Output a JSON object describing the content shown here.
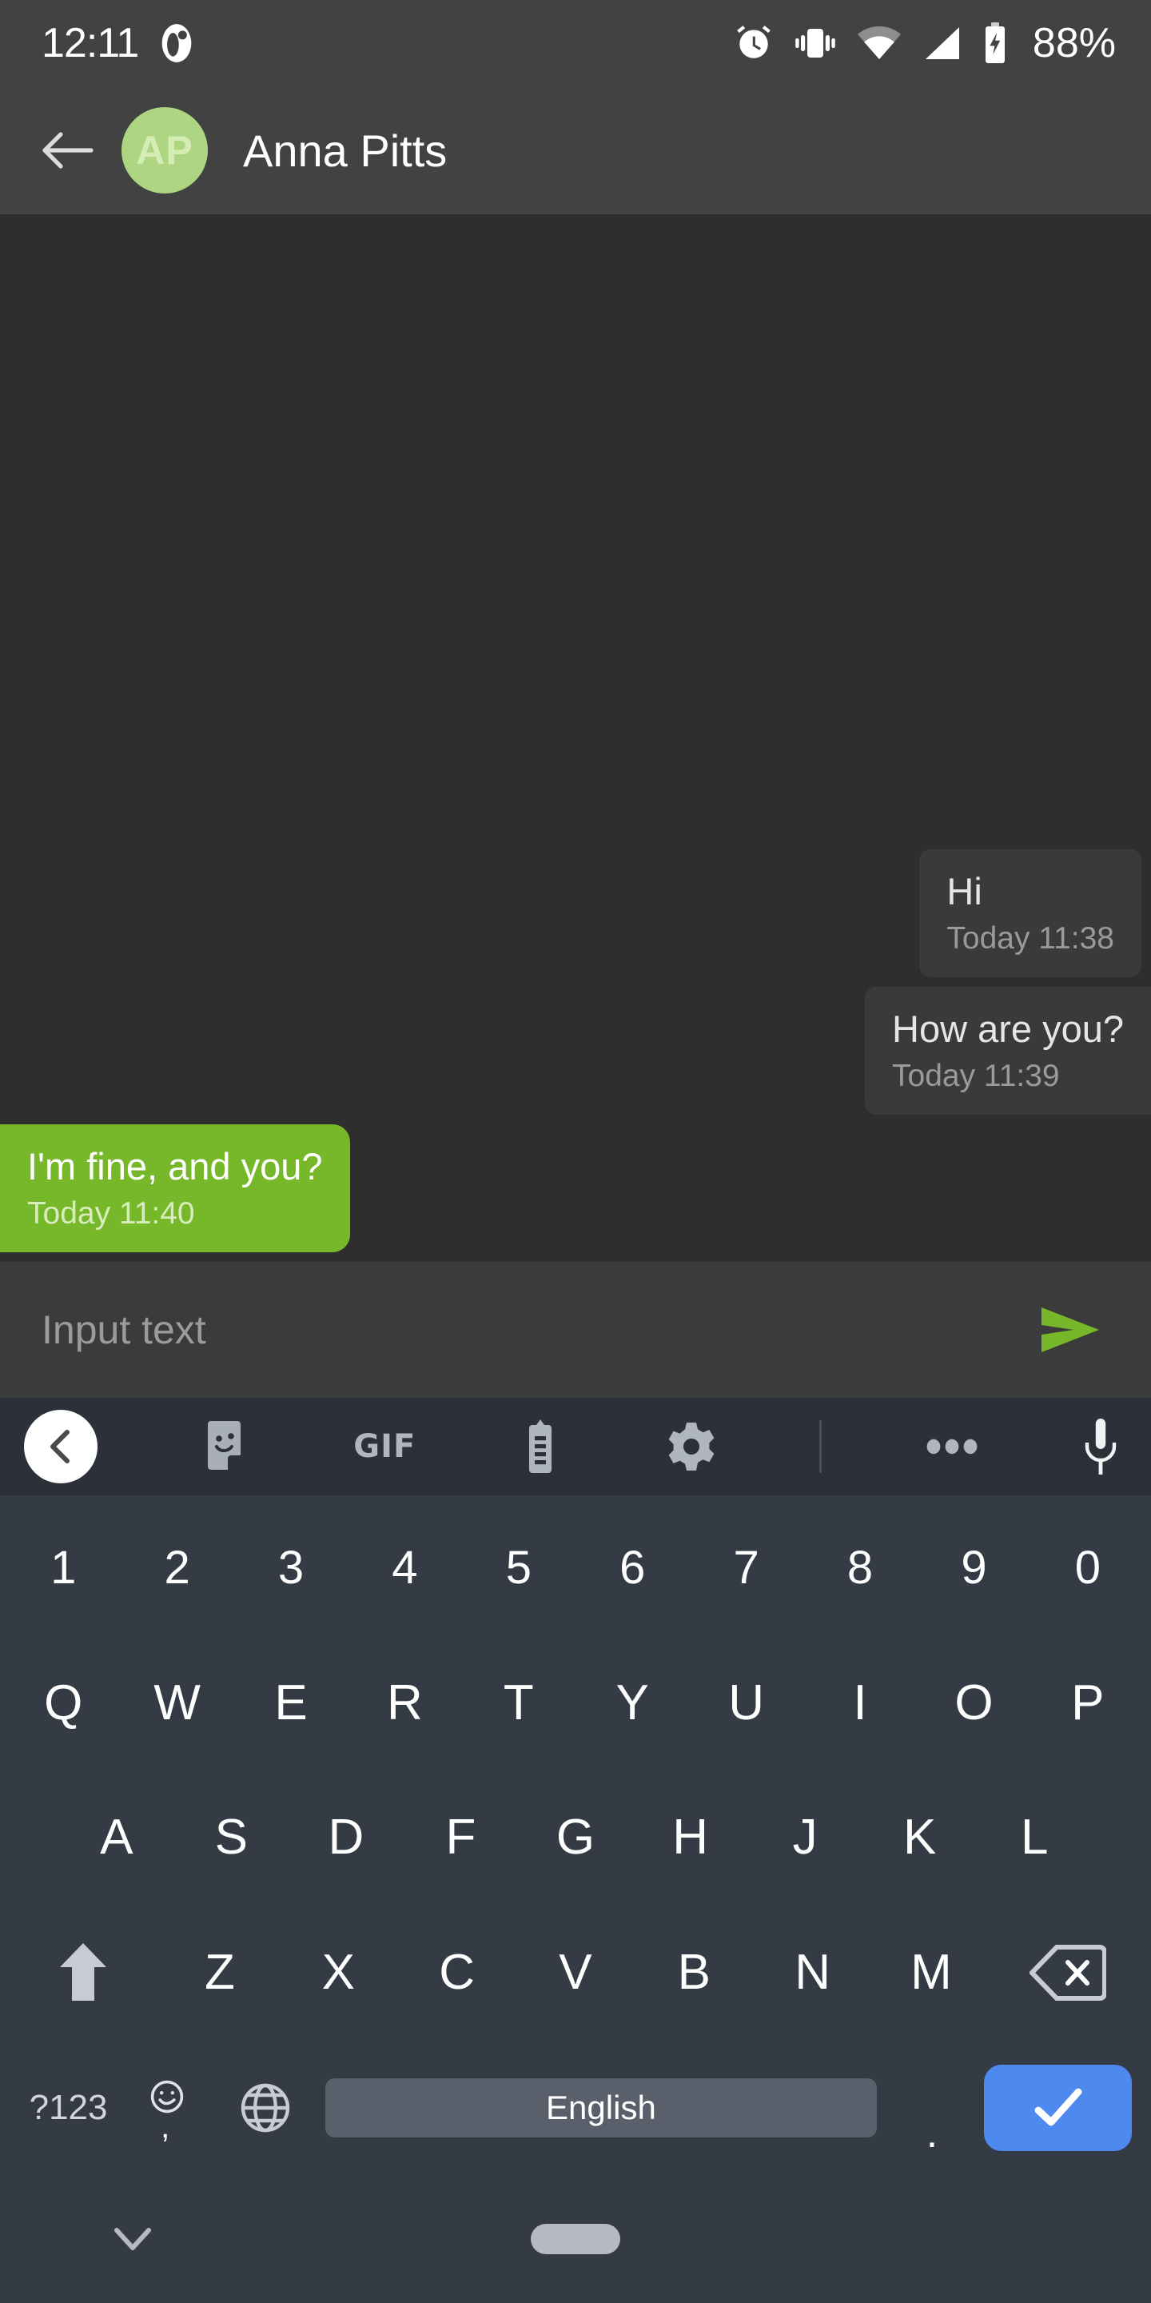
{
  "status_bar": {
    "time": "12:11",
    "battery_percent": "88%",
    "icons": [
      "notification-dot-icon",
      "alarm-icon",
      "vibrate-icon",
      "wifi-icon",
      "cellular-signal-icon",
      "battery-charging-icon"
    ]
  },
  "app_bar": {
    "back_label": "Back",
    "avatar_initials": "AP",
    "contact_name": "Anna Pitts",
    "avatar_color": "#aed581"
  },
  "messages": [
    {
      "text": "Hi",
      "time": "Today 11:38",
      "direction": "in"
    },
    {
      "text": "How are you?",
      "time": "Today 11:39",
      "direction": "in"
    },
    {
      "text": "I'm fine, and you?",
      "time": "Today 11:40",
      "direction": "out"
    }
  ],
  "input_bar": {
    "placeholder": "Input text",
    "send_label": "Send",
    "send_color": "#76b82a"
  },
  "keyboard_toolbar": {
    "items": [
      "collapse-toolbar",
      "sticker",
      "gif",
      "clipboard",
      "settings",
      "more-options",
      "voice-input"
    ],
    "gif_label": "GIF"
  },
  "keyboard": {
    "row_numbers": [
      "1",
      "2",
      "3",
      "4",
      "5",
      "6",
      "7",
      "8",
      "9",
      "0"
    ],
    "row_qwerty": [
      "Q",
      "W",
      "E",
      "R",
      "T",
      "Y",
      "U",
      "I",
      "O",
      "P"
    ],
    "row_asdf": [
      "A",
      "S",
      "D",
      "F",
      "G",
      "H",
      "J",
      "K",
      "L"
    ],
    "row_zxcv": [
      "Z",
      "X",
      "C",
      "V",
      "B",
      "N",
      "M"
    ],
    "shift_label": "Shift",
    "backspace_label": "Backspace",
    "symbols_label": "?123",
    "comma_label": ",",
    "language_label": "English",
    "period_label": ".",
    "enter_label": "Enter",
    "enter_color": "#4d89ef",
    "spacebar_color": "#59606b"
  },
  "nav_bar": {
    "dismiss_label": "Hide keyboard",
    "home_label": "Home"
  }
}
